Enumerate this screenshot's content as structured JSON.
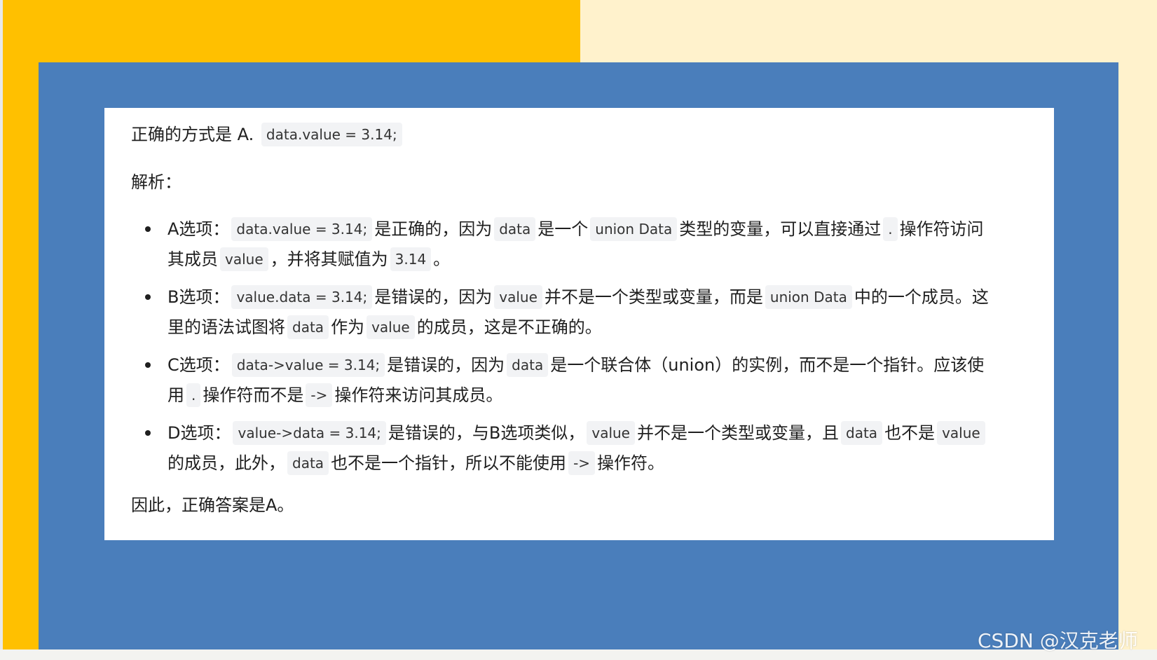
{
  "answer": {
    "prefix": "正确的方式是 A.",
    "code": "data.value = 3.14;"
  },
  "analysis_label": "解析：",
  "options": [
    {
      "l1": [
        {
          "t": "A选项："
        },
        {
          "c": "data.value = 3.14;"
        },
        {
          "t": "是正确的，因为"
        },
        {
          "c": "data"
        },
        {
          "t": "是一个"
        },
        {
          "c": "union Data"
        },
        {
          "t": "类型的变量，可以直接通过"
        },
        {
          "c": "."
        },
        {
          "t": "操作符访问"
        }
      ],
      "l2": [
        {
          "t": "其成员"
        },
        {
          "c": "value"
        },
        {
          "t": "，并将其赋值为"
        },
        {
          "c": "3.14"
        },
        {
          "t": "。"
        }
      ]
    },
    {
      "l1": [
        {
          "t": "B选项："
        },
        {
          "c": "value.data = 3.14;"
        },
        {
          "t": "是错误的，因为"
        },
        {
          "c": "value"
        },
        {
          "t": "并不是一个类型或变量，而是"
        },
        {
          "c": "union Data"
        },
        {
          "t": "中的一个成员。这"
        }
      ],
      "l2": [
        {
          "t": "里的语法试图将"
        },
        {
          "c": "data"
        },
        {
          "t": "作为"
        },
        {
          "c": "value"
        },
        {
          "t": "的成员，这是不正确的。"
        }
      ]
    },
    {
      "l1": [
        {
          "t": "C选项："
        },
        {
          "c": "data->value = 3.14;"
        },
        {
          "t": "是错误的，因为"
        },
        {
          "c": "data"
        },
        {
          "t": "是一个联合体（union）的实例，而不是一个指针。应该使"
        }
      ],
      "l2": [
        {
          "t": "用"
        },
        {
          "c": "."
        },
        {
          "t": "操作符而不是"
        },
        {
          "c": "->"
        },
        {
          "t": "操作符来访问其成员。"
        }
      ]
    },
    {
      "l1": [
        {
          "t": "D选项："
        },
        {
          "c": "value->data = 3.14;"
        },
        {
          "t": "是错误的，与B选项类似，"
        },
        {
          "c": "value"
        },
        {
          "t": "并不是一个类型或变量，且"
        },
        {
          "c": "data"
        },
        {
          "t": "也不是"
        },
        {
          "c": "value"
        }
      ],
      "l2": [
        {
          "t": "的成员，此外，"
        },
        {
          "c": "data"
        },
        {
          "t": "也不是一个指针，所以不能使用"
        },
        {
          "c": "->"
        },
        {
          "t": "操作符。"
        }
      ]
    }
  ],
  "conclusion": "因此，正确答案是A。",
  "watermark": "CSDN @汉克老师",
  "colors": {
    "yellow": "#ffc000",
    "cream": "#fff2cc",
    "blue": "#4a7ebb",
    "card": "#ffffff",
    "code_bg": "#f2f3f5"
  }
}
